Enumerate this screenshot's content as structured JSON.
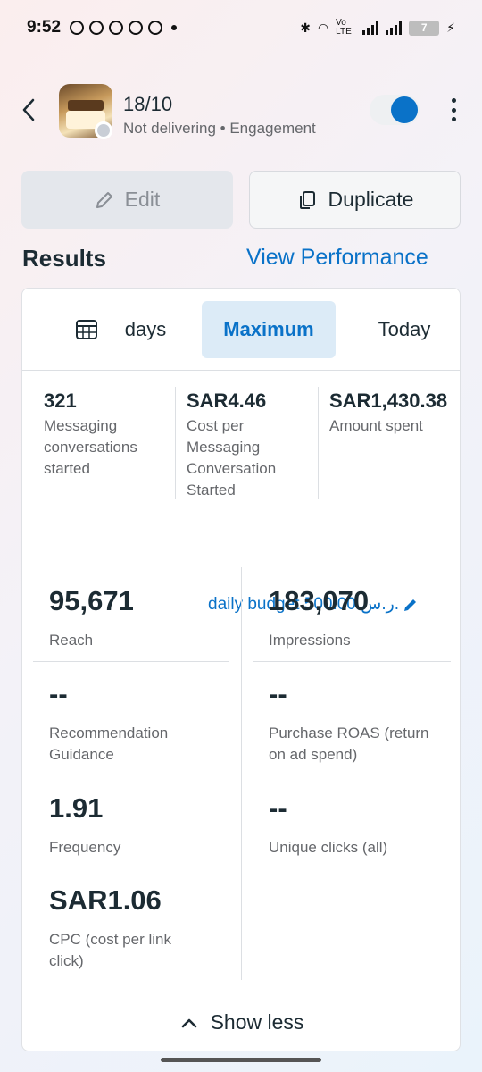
{
  "status_bar": {
    "time": "9:52",
    "network": "Vo LTE",
    "battery": "7"
  },
  "header": {
    "title": "18/10",
    "subtitle": "Not delivering • Engagement"
  },
  "actions": {
    "edit": "Edit",
    "duplicate": "Duplicate"
  },
  "results": {
    "title": "Results",
    "view_performance": "View Performance"
  },
  "tabs": {
    "days": "days",
    "maximum": "Maximum",
    "today": "Today"
  },
  "kpis": [
    {
      "value": "321",
      "label": "Messaging conversations started"
    },
    {
      "value": "SAR4.46",
      "label": "Cost per Messaging Conversation Started"
    },
    {
      "value": "SAR1,430.38",
      "label": "Amount spent"
    }
  ],
  "budget": "daily budget 500.00 ر.س.",
  "metrics": [
    {
      "value": "95,671",
      "label": "Reach"
    },
    {
      "value": "183,070",
      "label": "Impressions"
    },
    {
      "value": "--",
      "label": "Recommendation Guidance"
    },
    {
      "value": "--",
      "label": "Purchase ROAS (return on ad spend)"
    },
    {
      "value": "1.91",
      "label": "Frequency"
    },
    {
      "value": "--",
      "label": "Unique clicks (all)"
    },
    {
      "value": "SAR1.06",
      "label": "CPC (cost per link click)"
    }
  ],
  "footer": {
    "show_less": "Show less"
  },
  "colors": {
    "accent": "#0a72c8",
    "text": "#1c2b33",
    "muted": "#65676b"
  }
}
